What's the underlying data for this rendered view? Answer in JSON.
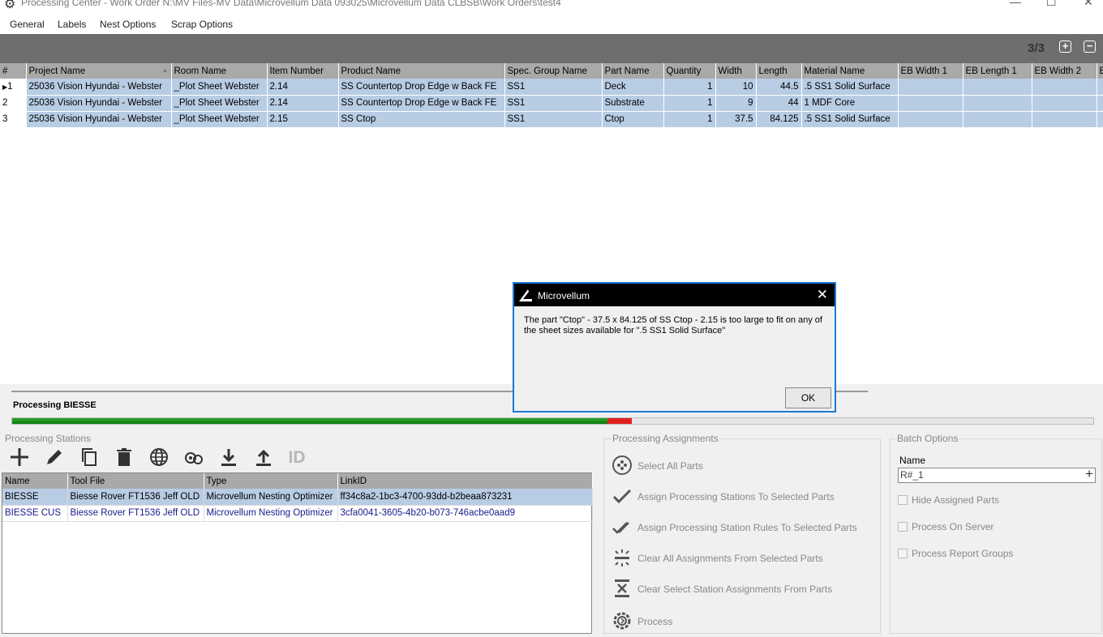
{
  "window": {
    "title": "Processing Center - Work Order N:\\MV Files-MV Data\\Microvellum Data 093025\\Microvellum Data CLBSB\\Work Orders\\test4",
    "icon": "gear-icon",
    "minimize": "—",
    "maximize": "☐",
    "close": "✕"
  },
  "menu": [
    "General",
    "Labels",
    "Nest Options",
    "Scrap Options"
  ],
  "toolbar_top": {
    "page_count": "3/3",
    "add": "+",
    "remove": "−"
  },
  "parts_grid": {
    "columns": [
      "#",
      "Project Name",
      "Room Name",
      "Item Number",
      "Product Name",
      "Spec. Group Name",
      "Part Name",
      "Quantity",
      "Width",
      "Length",
      "Material Name",
      "EB Width 1",
      "EB Length 1",
      "EB Width 2",
      "E"
    ],
    "rows": [
      {
        "num": "1",
        "project": "25036 Vision Hyundai - Webster",
        "room": "_Plot Sheet Webster",
        "item": "2.14",
        "product": "SS Countertop Drop Edge w Back FE",
        "spec": "SS1",
        "part": "Deck",
        "qty": "1",
        "width": "10",
        "length": "44.5",
        "material": ".5 SS1 Solid Surface"
      },
      {
        "num": "2",
        "project": "25036 Vision Hyundai - Webster",
        "room": "_Plot Sheet Webster",
        "item": "2.14",
        "product": "SS Countertop Drop Edge w Back FE",
        "spec": "SS1",
        "part": "Substrate",
        "qty": "1",
        "width": "9",
        "length": "44",
        "material": "1 MDF Core"
      },
      {
        "num": "3",
        "project": "25036 Vision Hyundai - Webster",
        "room": "_Plot Sheet Webster",
        "item": "2.15",
        "product": "SS Ctop",
        "spec": "SS1",
        "part": "Ctop",
        "qty": "1",
        "width": "37.5",
        "length": "84.125",
        "material": ".5 SS1 Solid Surface"
      }
    ]
  },
  "processing": {
    "label": "Processing BIESSE",
    "progress_fraction": 0.551
  },
  "stations_group": {
    "title": "Processing Stations",
    "toolbar_id_label": "ID",
    "columns": [
      "Name",
      "Tool File",
      "Type",
      "LinkID"
    ],
    "rows": [
      {
        "name": "BIESSE",
        "tool": "Biesse Rover FT1536 Jeff OLD",
        "type": "Microvellum Nesting Optimizer",
        "link": "ff34c8a2-1bc3-4700-93dd-b2beaa873231"
      },
      {
        "name": "BIESSE CUS",
        "tool": "Biesse Rover FT1536 Jeff OLD",
        "type": "Microvellum Nesting Optimizer",
        "link": "3cfa0041-3605-4b20-b073-746acbe0aad9"
      }
    ]
  },
  "assignments_group": {
    "title": "Processing Assignments",
    "items": [
      "Select All Parts",
      "Assign Processing Stations To Selected Parts",
      "Assign Processing Station Rules To Selected Parts",
      "Clear All Assignments From Selected Parts",
      "Clear Select Station Assignments From Parts",
      "Process"
    ]
  },
  "batch_group": {
    "title": "Batch Options",
    "name_label": "Name",
    "name_value": "R#_1",
    "options": [
      "Hide Assigned Parts",
      "Process On Server",
      "Process Report Groups"
    ]
  },
  "dialog": {
    "title": "Microvellum",
    "message": "The part  \"Ctop\" - 37.5 x 84.125 of SS Ctop - 2.15 is too large to fit on any of the sheet sizes available for \".5 SS1 Solid Surface\"",
    "ok_label": "OK"
  },
  "colors": {
    "selection": "#b8cce4",
    "header": "#a9a9a9",
    "progress_green": "#0b7a0b",
    "progress_red": "#e02020",
    "dialog_border": "#1a7ad4"
  }
}
